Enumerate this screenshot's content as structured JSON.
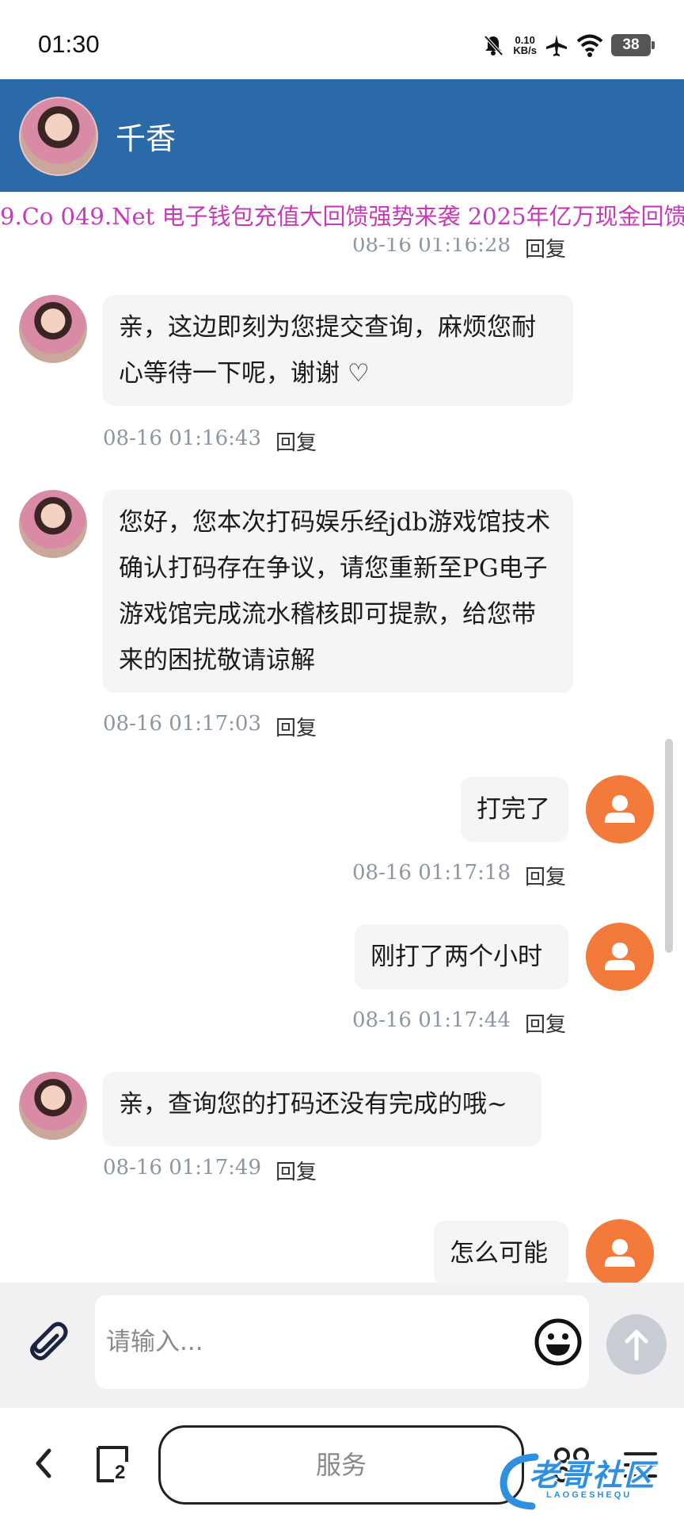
{
  "status_bar": {
    "time": "01:30",
    "net_speed_value": "0.10",
    "net_speed_unit": "KB/s",
    "battery": "38"
  },
  "header": {
    "title": "千香"
  },
  "marquee": {
    "text": "9.Co 049.Net 电子钱包充值大回馈强势来袭 2025年亿万现金回馈"
  },
  "messages": [
    {
      "time": "08-16 01:16:28",
      "reply": "回复"
    },
    {
      "sender": "agent",
      "text": "亲，这边即刻为您提交查询，麻烦您耐心等待一下呢，谢谢 ♡",
      "time": "08-16 01:16:43",
      "reply": "回复"
    },
    {
      "sender": "agent",
      "text": "您好，您本次打码娱乐经jdb游戏馆技术确认打码存在争议，请您重新至PG电子游戏馆完成流水稽核即可提款，给您带来的困扰敬请谅解",
      "time": "08-16 01:17:03",
      "reply": "回复"
    },
    {
      "sender": "user",
      "text": "打完了",
      "time": "08-16 01:17:18",
      "reply": "回复"
    },
    {
      "sender": "user",
      "text": "刚打了两个小时",
      "time": "08-16 01:17:44",
      "reply": "回复"
    },
    {
      "sender": "agent",
      "text": "亲，查询您的打码还没有完成的哦~",
      "time": "08-16 01:17:49",
      "reply": "回复"
    },
    {
      "sender": "user",
      "text": "怎么可能"
    }
  ],
  "input": {
    "placeholder": "请输入..."
  },
  "nav_bar": {
    "tab_count": "2",
    "service_label": "服务",
    "watermark": "老哥社区",
    "watermark_sub": "LAOGESHEQU"
  },
  "colors": {
    "header_bg": "#2a6aa8",
    "marquee_text": "#c73ab8",
    "user_avatar": "#f47a3c",
    "bubble_bg": "#f5f5f5",
    "timestamp": "#8d96a3"
  }
}
